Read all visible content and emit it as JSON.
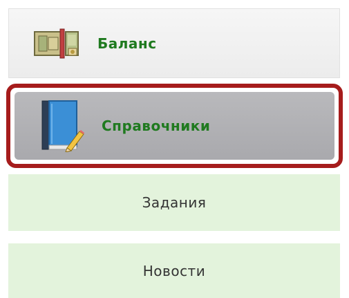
{
  "menu": {
    "items": [
      {
        "label": "Баланс",
        "icon": "money-bills-icon",
        "highlighted": false
      },
      {
        "label": "Справочники",
        "icon": "book-pencil-icon",
        "highlighted": true
      },
      {
        "label": "Задания"
      },
      {
        "label": "Новости"
      }
    ]
  },
  "colors": {
    "active_label": "#1f7a1f",
    "highlight_border": "#a61c1c",
    "selected_bg": "#b3b3b6",
    "green_item_bg": "#e3f3dc"
  }
}
